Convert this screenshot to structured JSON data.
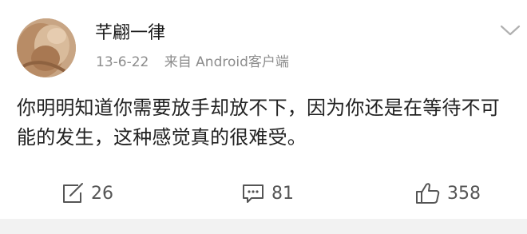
{
  "post": {
    "author": "芊翩一律",
    "time": "13-6-22",
    "source": "来自 Android客户端",
    "content": "你明明知道你需要放手却放不下，因为你还是在等待不可能的发生，这种感觉真的很难受。",
    "actions": {
      "forward_count": "26",
      "comment_count": "81",
      "like_count": "358"
    }
  },
  "icons": {
    "menu": "chevron-down-icon",
    "forward": "share-icon",
    "comment": "comment-icon",
    "like": "thumbs-up-icon"
  },
  "colors": {
    "text": "#222222",
    "meta": "#8c8c8c",
    "action": "#555555",
    "divider": "#f2f2f2"
  }
}
